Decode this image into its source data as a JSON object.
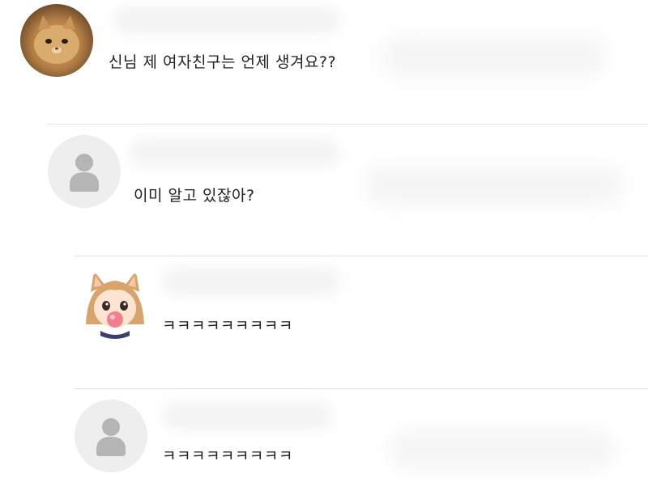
{
  "comments": [
    {
      "text": "신님 제 여자친구는 언제 생겨요??"
    },
    {
      "text": "이미 알고 있잖아?"
    },
    {
      "text": "ㅋㅋㅋㅋㅋㅋㅋㅋㅋ"
    },
    {
      "text": "ㅋㅋㅋㅋㅋㅋㅋㅋㅋ"
    }
  ],
  "icons": {
    "default_avatar": "user-silhouette-icon"
  },
  "colors": {
    "text": "#222222",
    "divider": "#e2e2e2",
    "default_avatar_bg": "#eeeeee",
    "default_avatar_fg": "#b5b5b5"
  }
}
